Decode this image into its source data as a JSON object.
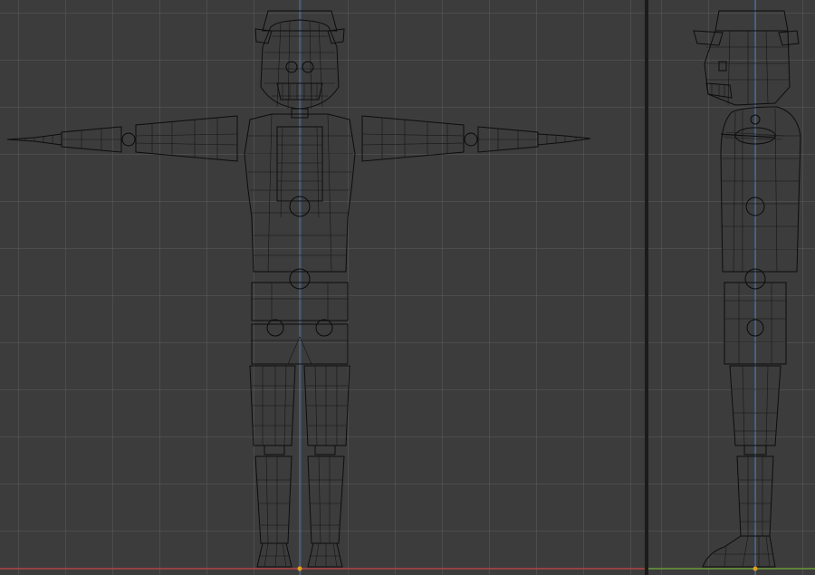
{
  "viewports": [
    {
      "id": "front",
      "view": "front-orthographic"
    },
    {
      "id": "side",
      "view": "side-orthographic"
    }
  ],
  "colors": {
    "background": "#3c3c3c",
    "grid": "#5a5a5a",
    "wire": "#0d0d0d",
    "axis_z": "#4d79b8",
    "axis_x": "#b04444",
    "axis_y": "#6a9a3a",
    "origin": "#e0a020"
  },
  "display": {
    "mode": "wireframe",
    "grid": true
  }
}
